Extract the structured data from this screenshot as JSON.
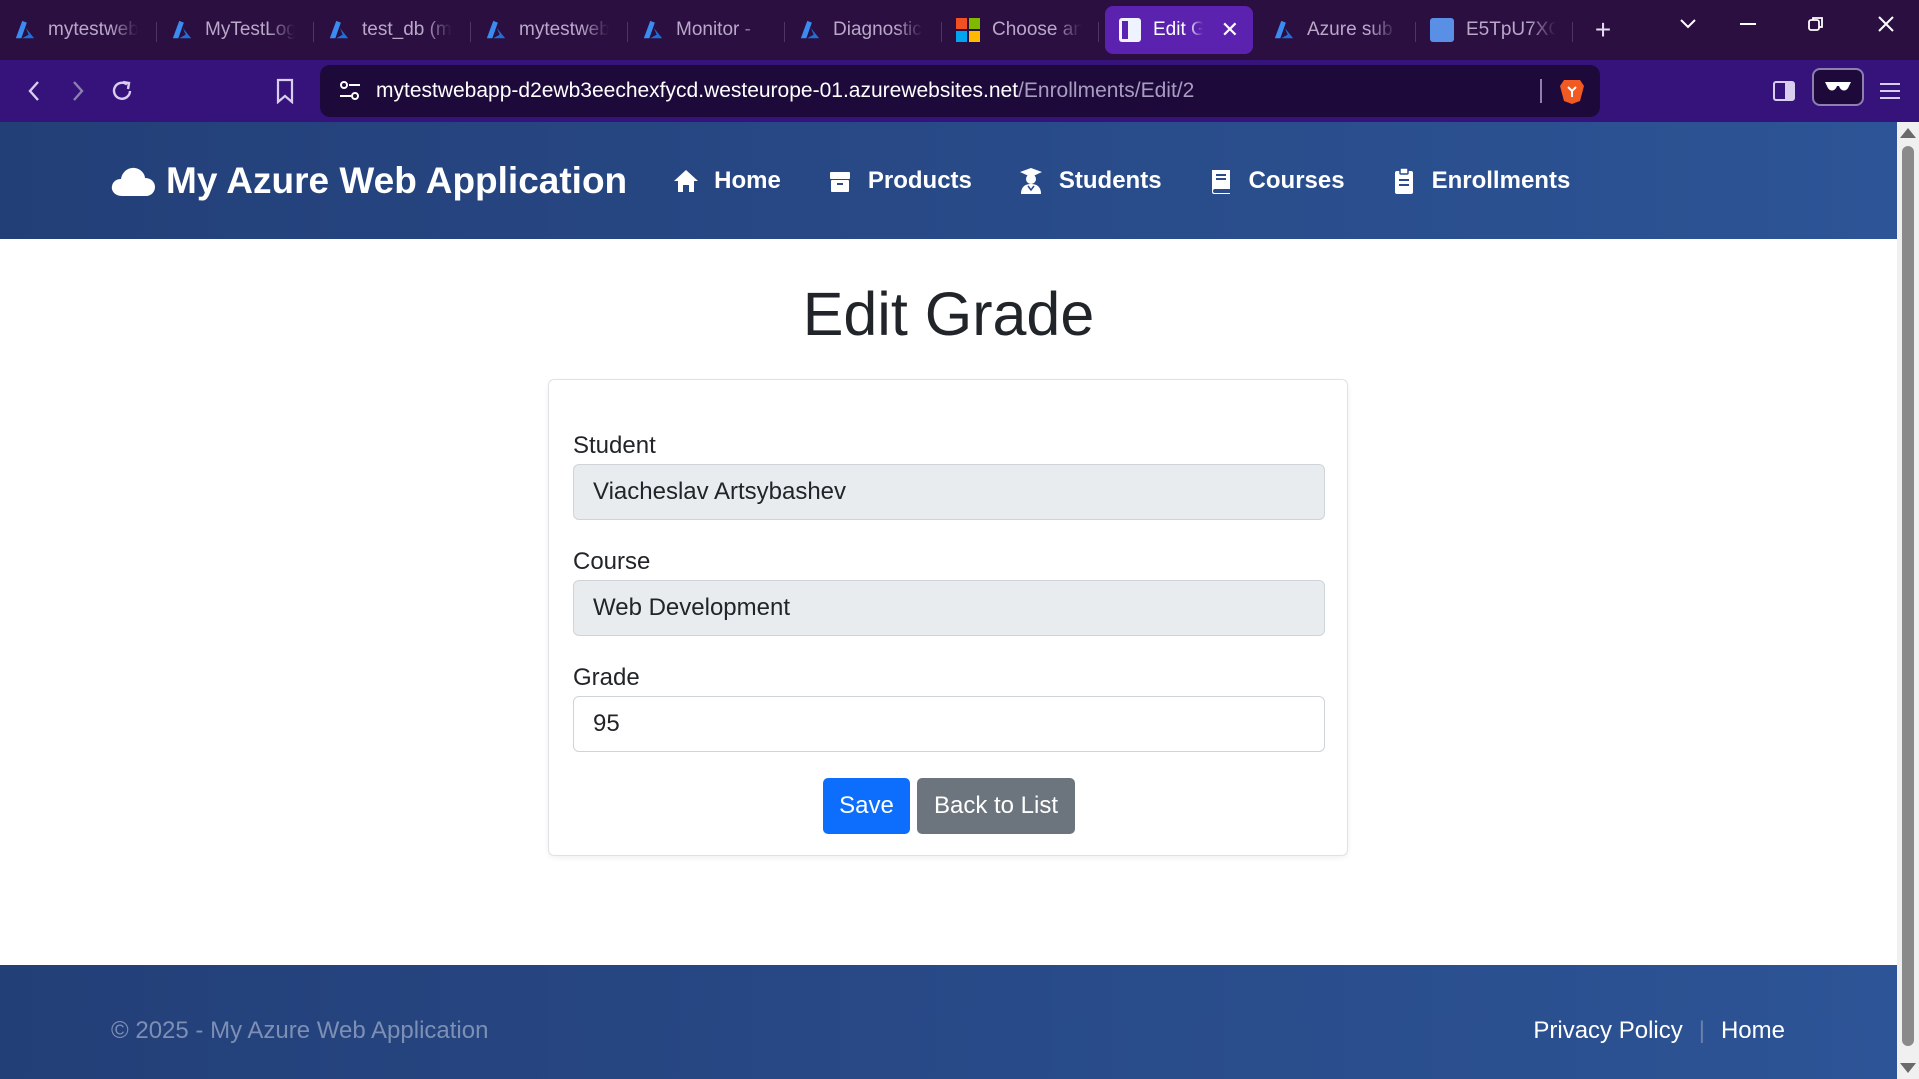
{
  "browser": {
    "tabs": [
      {
        "label": "mytestwebapp",
        "favicon": "azure-icon"
      },
      {
        "label": "MyTestLogs",
        "favicon": "azure-icon"
      },
      {
        "label": "test_db (m",
        "favicon": "azure-icon"
      },
      {
        "label": "mytestwebapp",
        "favicon": "azure-icon"
      },
      {
        "label": "Monitor -",
        "favicon": "azure-icon"
      },
      {
        "label": "Diagnostic",
        "favicon": "azure-icon"
      },
      {
        "label": "Choose an",
        "favicon": "microsoft-icon"
      },
      {
        "label": "Edit G",
        "favicon": "document-icon",
        "active": true
      },
      {
        "label": "Azure sub",
        "favicon": "azure-icon"
      },
      {
        "label": "E5TpU7XC",
        "favicon": "image-icon"
      }
    ],
    "new_tab_label": "+",
    "url": {
      "host": "mytestwebapp-d2ewb3eechexfycd.westeurope-01.azurewebsites.net",
      "path": "/Enrollments/Edit/2"
    }
  },
  "site": {
    "brand": "My Azure Web Application",
    "nav": [
      {
        "label": "Home",
        "icon": "home-icon"
      },
      {
        "label": "Products",
        "icon": "box-icon"
      },
      {
        "label": "Students",
        "icon": "graduate-icon"
      },
      {
        "label": "Courses",
        "icon": "book-icon"
      },
      {
        "label": "Enrollments",
        "icon": "clipboard-icon"
      }
    ]
  },
  "form": {
    "title": "Edit Grade",
    "student_label": "Student",
    "student_value": "Viacheslav Artsybashev",
    "course_label": "Course",
    "course_value": "Web Development",
    "grade_label": "Grade",
    "grade_value": "95",
    "save_label": "Save",
    "back_label": "Back to List"
  },
  "footer": {
    "copyright": "© 2025 - My Azure Web Application",
    "links": [
      "Privacy Policy",
      "Home"
    ],
    "separator": "|"
  },
  "colors": {
    "nav_bg": "#2a4a8a",
    "primary": "#0d6efd",
    "secondary": "#6c757d",
    "readonly_bg": "#e9ecef"
  }
}
